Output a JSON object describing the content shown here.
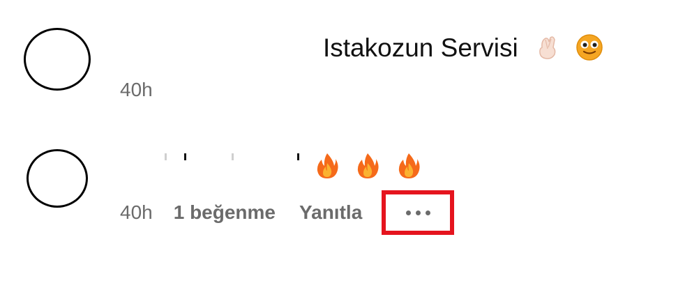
{
  "comments": [
    {
      "text": "Istakozun Servisi",
      "emojis": [
        "crossed-fingers",
        "smiley-face"
      ],
      "time": "40h"
    },
    {
      "text": "",
      "emojis": [
        "fire",
        "fire",
        "fire"
      ],
      "time": "40h",
      "likes": "1 beğenme",
      "reply": "Yanıtla"
    }
  ],
  "colors": {
    "highlight": "#e5141e",
    "meta_text": "#6b6b6b"
  }
}
